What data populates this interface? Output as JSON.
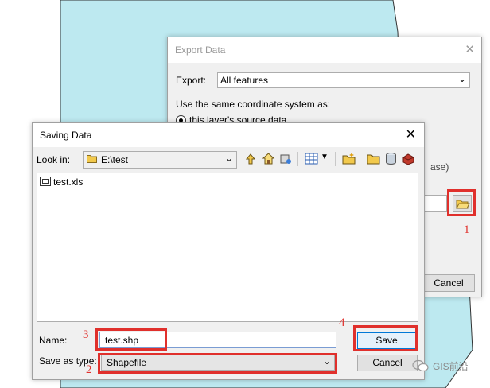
{
  "export_dialog": {
    "title": "Export Data",
    "close_glyph": "✕",
    "export_label": "Export:",
    "export_value": "All features",
    "coord_text": "Use the same coordinate system as:",
    "radio_label": "this layer's source data",
    "partial_text": "ase)",
    "cancel_label": "Cancel"
  },
  "saving_dialog": {
    "title": "Saving Data",
    "close_glyph": "✕",
    "lookin_label": "Look in:",
    "lookin_value": "E:\\test",
    "files": [
      "test.xls"
    ],
    "name_label": "Name:",
    "name_value": "test.shp",
    "type_label": "Save as type:",
    "type_value": "Shapefile",
    "save_label": "Save",
    "cancel_label": "Cancel"
  },
  "annotations": {
    "n1": "1",
    "n2": "2",
    "n3": "3",
    "n4": "4",
    "color": "#e0302c"
  },
  "watermark": "GIS前沿",
  "colors": {
    "map_fill": "#bde9f0",
    "dialog_bg": "#f0f0f0",
    "accent": "#0078d7"
  }
}
